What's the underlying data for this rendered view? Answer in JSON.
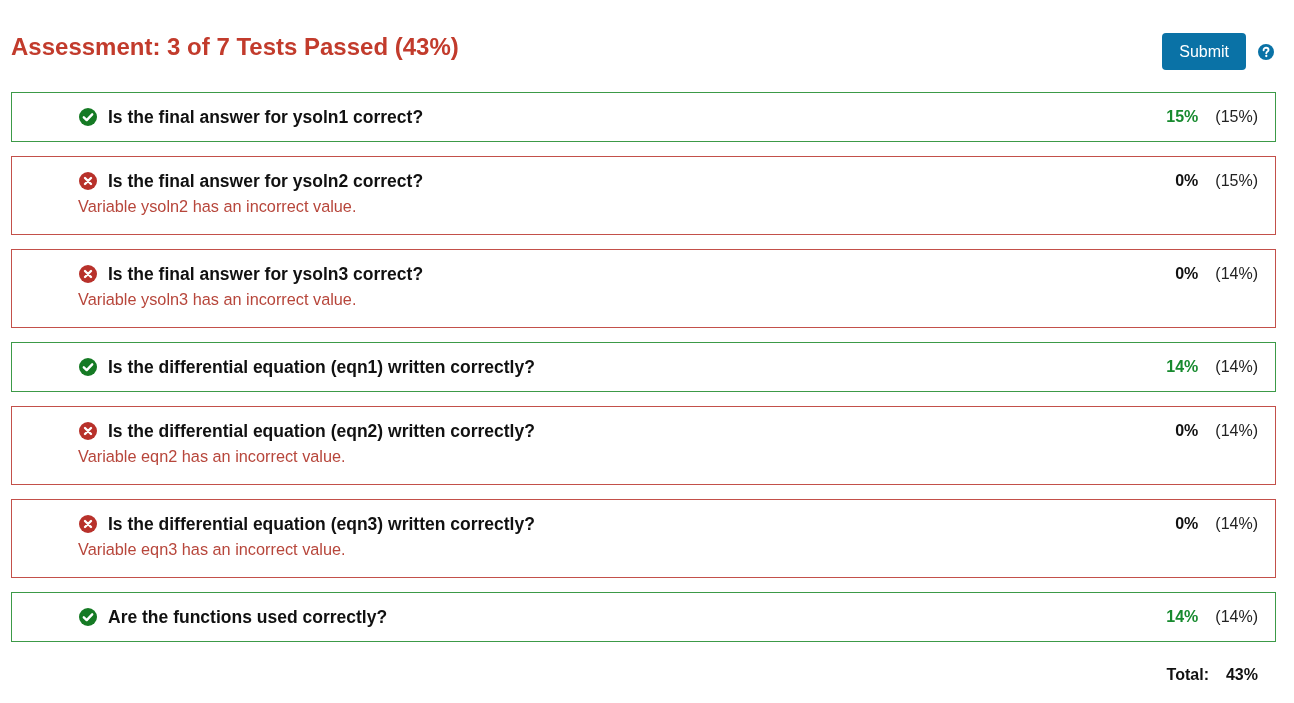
{
  "header": {
    "title": "Assessment: 3 of 7 Tests Passed (43%)",
    "submit_button": "Submit"
  },
  "tests": [
    {
      "passed": true,
      "title": "Is the final answer for ysoln1 correct?",
      "score": "15%",
      "weight": "(15%)"
    },
    {
      "passed": false,
      "title": "Is the final answer for ysoln2 correct?",
      "message": "Variable ysoln2 has an incorrect value.",
      "score": "0%",
      "weight": "(15%)"
    },
    {
      "passed": false,
      "title": "Is the final answer for ysoln3 correct?",
      "message": "Variable ysoln3 has an incorrect value.",
      "score": "0%",
      "weight": "(14%)"
    },
    {
      "passed": true,
      "title": "Is the differential equation (eqn1) written correctly?",
      "score": "14%",
      "weight": "(14%)"
    },
    {
      "passed": false,
      "title": "Is the differential equation (eqn2) written correctly?",
      "message": "Variable eqn2 has an incorrect value.",
      "score": "0%",
      "weight": "(14%)"
    },
    {
      "passed": false,
      "title": "Is the differential equation (eqn3) written correctly?",
      "message": "Variable eqn3 has an incorrect value.",
      "score": "0%",
      "weight": "(14%)"
    },
    {
      "passed": true,
      "title": "Are the functions used correctly?",
      "score": "14%",
      "weight": "(14%)"
    }
  ],
  "total": {
    "label": "Total:",
    "value": "43%"
  }
}
